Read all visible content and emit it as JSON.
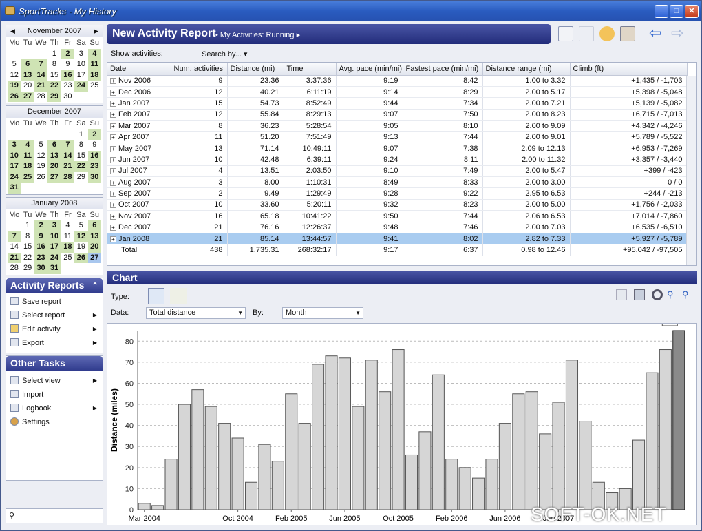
{
  "window": {
    "title": "SportTracks - My History",
    "min": "_",
    "max": "□",
    "close": "✕"
  },
  "calendars": [
    {
      "title": "November 2007",
      "days": [
        "Mo",
        "Tu",
        "We",
        "Th",
        "Fr",
        "Sa",
        "Su"
      ],
      "cells": [
        "",
        "",
        "",
        "1",
        "2",
        "3",
        "4",
        "5",
        "6",
        "7",
        "8",
        "9",
        "10",
        "11",
        "12",
        "13",
        "14",
        "15",
        "16",
        "17",
        "18",
        "19",
        "20",
        "21",
        "22",
        "23",
        "24",
        "25",
        "26",
        "27",
        "28",
        "29",
        "30"
      ],
      "active": [
        "2",
        "4",
        "6",
        "7",
        "11",
        "13",
        "14",
        "16",
        "18",
        "19",
        "21",
        "22",
        "24",
        "26",
        "27",
        "29"
      ]
    },
    {
      "title": "December 2007",
      "days": [
        "Mo",
        "Tu",
        "We",
        "Th",
        "Fr",
        "Sa",
        "Su"
      ],
      "cells": [
        "",
        "",
        "",
        "",
        "",
        "1",
        "2",
        "3",
        "4",
        "5",
        "6",
        "7",
        "8",
        "9",
        "10",
        "11",
        "12",
        "13",
        "14",
        "15",
        "16",
        "17",
        "18",
        "19",
        "20",
        "21",
        "22",
        "23",
        "24",
        "25",
        "26",
        "27",
        "28",
        "29",
        "30",
        "31"
      ],
      "active": [
        "2",
        "3",
        "4",
        "6",
        "7",
        "10",
        "11",
        "13",
        "14",
        "16",
        "17",
        "18",
        "20",
        "21",
        "22",
        "23",
        "24",
        "25",
        "27",
        "28",
        "30",
        "31"
      ]
    },
    {
      "title": "January 2008",
      "days": [
        "Mo",
        "Tu",
        "We",
        "Th",
        "Fr",
        "Sa",
        "Su"
      ],
      "cells": [
        "",
        "1",
        "2",
        "3",
        "4",
        "5",
        "6",
        "7",
        "8",
        "9",
        "10",
        "11",
        "12",
        "13",
        "14",
        "15",
        "16",
        "17",
        "18",
        "19",
        "20",
        "21",
        "22",
        "23",
        "24",
        "25",
        "26",
        "27",
        "28",
        "29",
        "30",
        "31"
      ],
      "active": [
        "2",
        "3",
        "6",
        "7",
        "9",
        "10",
        "12",
        "13",
        "16",
        "17",
        "18",
        "20",
        "21",
        "23",
        "24",
        "26",
        "27",
        "30",
        "31"
      ],
      "selected": [
        "27"
      ]
    }
  ],
  "activity_panel": {
    "title": "Activity Reports",
    "items": [
      "Save report",
      "Select report",
      "Edit activity",
      "Export"
    ]
  },
  "tasks_panel": {
    "title": "Other Tasks",
    "items": [
      "Select view",
      "Import",
      "Logbook",
      "Settings"
    ]
  },
  "report": {
    "title": "New Activity Report",
    "subtitle": "• My Activities: Running ▸",
    "show_label": "Show activities:",
    "search_label": "Search by... ▾"
  },
  "grid": {
    "columns": [
      "Date",
      "Num. activities",
      "Distance (mi)",
      "Time",
      "Avg. pace (min/mi)",
      "Fastest pace (min/mi)",
      "Distance range (mi)",
      "Climb (ft)"
    ],
    "rows": [
      [
        "Nov 2006",
        "9",
        "23.36",
        "3:37:36",
        "9:19",
        "8:42",
        "1.00 to 3.32",
        "+1,435 / -1,703"
      ],
      [
        "Dec 2006",
        "12",
        "40.21",
        "6:11:19",
        "9:14",
        "8:29",
        "2.00 to 5.17",
        "+5,398 / -5,048"
      ],
      [
        "Jan 2007",
        "15",
        "54.73",
        "8:52:49",
        "9:44",
        "7:34",
        "2.00 to 7.21",
        "+5,139 / -5,082"
      ],
      [
        "Feb 2007",
        "12",
        "55.84",
        "8:29:13",
        "9:07",
        "7:50",
        "2.00 to 8.23",
        "+6,715 / -7,013"
      ],
      [
        "Mar 2007",
        "8",
        "36.23",
        "5:28:54",
        "9:05",
        "8:10",
        "2.00 to 9.09",
        "+4,342 / -4,246"
      ],
      [
        "Apr 2007",
        "11",
        "51.20",
        "7:51:49",
        "9:13",
        "7:44",
        "2.00 to 9.01",
        "+5,789 / -5,522"
      ],
      [
        "May 2007",
        "13",
        "71.14",
        "10:49:11",
        "9:07",
        "7:38",
        "2.09 to 12.13",
        "+6,953 / -7,269"
      ],
      [
        "Jun 2007",
        "10",
        "42.48",
        "6:39:11",
        "9:24",
        "8:11",
        "2.00 to 11.32",
        "+3,357 / -3,440"
      ],
      [
        "Jul 2007",
        "4",
        "13.51",
        "2:03:50",
        "9:10",
        "7:49",
        "2.00 to 5.47",
        "+399 / -423"
      ],
      [
        "Aug 2007",
        "3",
        "8.00",
        "1:10:31",
        "8:49",
        "8:33",
        "2.00 to 3.00",
        "0 / 0"
      ],
      [
        "Sep 2007",
        "2",
        "9.49",
        "1:29:49",
        "9:28",
        "9:22",
        "2.95 to 6.53",
        "+244 / -213"
      ],
      [
        "Oct 2007",
        "10",
        "33.60",
        "5:20:11",
        "9:32",
        "8:23",
        "2.00 to 5.00",
        "+1,756 / -2,033"
      ],
      [
        "Nov 2007",
        "16",
        "65.18",
        "10:41:22",
        "9:50",
        "7:44",
        "2.06 to 6.53",
        "+7,014 / -7,860"
      ],
      [
        "Dec 2007",
        "21",
        "76.16",
        "12:26:37",
        "9:48",
        "7:46",
        "2.00 to 7.03",
        "+6,535 / -6,510"
      ],
      [
        "Jan 2008",
        "21",
        "85.14",
        "13:44:57",
        "9:41",
        "8:02",
        "2.82 to 7.33",
        "+5,927 / -5,789"
      ]
    ],
    "total": [
      "Total",
      "438",
      "1,735.31",
      "268:32:17",
      "9:17",
      "6:37",
      "0.98 to 12.46",
      "+95,042 / -97,505"
    ],
    "selected_row": 14
  },
  "chart_panel": {
    "title": "Chart",
    "type_label": "Type:",
    "data_label": "Data:",
    "data_value": "Total distance",
    "by_label": "By:",
    "by_value": "Month"
  },
  "chart_data": {
    "type": "bar",
    "ylabel": "Distance (miles)",
    "ylim": [
      0,
      85
    ],
    "yticks": [
      0,
      10,
      20,
      30,
      40,
      50,
      60,
      70,
      80
    ],
    "values": [
      3,
      2,
      24,
      50,
      57,
      49,
      41,
      34,
      13,
      31,
      23,
      55,
      41,
      69,
      73,
      72,
      49,
      71,
      56,
      76,
      26,
      37,
      64,
      24,
      20,
      15,
      24,
      41,
      55,
      56,
      36,
      51,
      71,
      42,
      13,
      8,
      10,
      33,
      65,
      76,
      85
    ],
    "xtick_labels": [
      {
        "i": 0,
        "label": "Mar 2004"
      },
      {
        "i": 7,
        "label": "Oct 2004"
      },
      {
        "i": 11,
        "label": "Feb 2005"
      },
      {
        "i": 15,
        "label": "Jun 2005"
      },
      {
        "i": 19,
        "label": "Oct 2005"
      },
      {
        "i": 23,
        "label": "Feb 2006"
      },
      {
        "i": 27,
        "label": "Jun 2006"
      },
      {
        "i": 31,
        "label": "Jan 2007"
      }
    ],
    "highlight_index": 40,
    "highlight_label": "85",
    "grid": true
  },
  "watermark": "SOFT-OK.NET"
}
